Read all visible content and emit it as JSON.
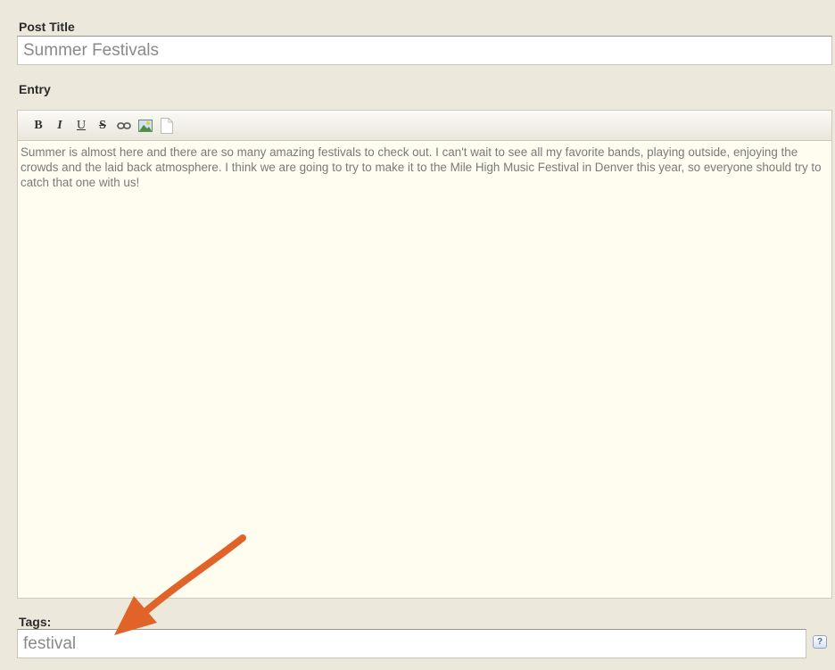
{
  "post_title": {
    "label": "Post Title",
    "value": "Summer Festivals"
  },
  "entry": {
    "label": "Entry",
    "toolbar": {
      "bold": "B",
      "italic": "I",
      "underline": "U",
      "strikethrough": "S",
      "link_icon": "link-icon",
      "image_icon": "image-icon",
      "page_icon": "page-icon"
    },
    "text": "Summer is almost here and there are so many amazing festivals to check out. I can't wait to see all my favorite bands, playing outside, enjoying the crowds and the laid back atmosphere. I think we are going to try to make it to the Mile High Music Festival in Denver this year, so everyone should try to catch that one with us!"
  },
  "tags": {
    "label": "Tags:",
    "value": "festival",
    "help_icon": "help-icon",
    "help_text": "?"
  },
  "colors": {
    "background": "#ede8dc",
    "editor_bg": "#fffdef",
    "arrow": "#e0642a"
  }
}
